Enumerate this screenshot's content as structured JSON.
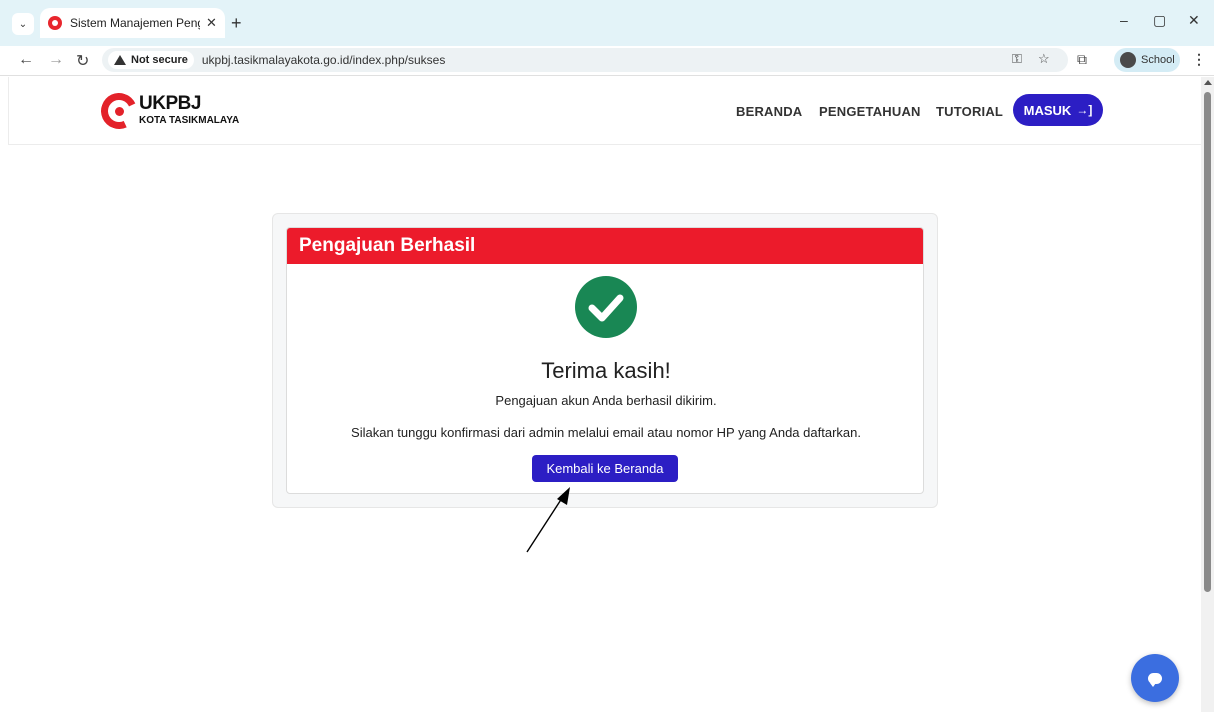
{
  "browser": {
    "tab_title": "Sistem Manajemen Pengetahuan",
    "tab_close": "✕",
    "new_tab": "+",
    "security_label": "Not secure",
    "url": "ukpbj.tasikmalayakota.go.id/index.php/sukses",
    "profile_name": "School",
    "window_controls": [
      "–",
      "▢",
      "✕"
    ]
  },
  "header": {
    "logo_title": "UKPBJ",
    "logo_subtitle": "KOTA TASIKMALAYA",
    "nav": [
      "BERANDA",
      "PENGETAHUAN",
      "TUTORIAL"
    ],
    "login_label": "MASUK",
    "login_icon": "→]"
  },
  "card": {
    "heading": "Pengajuan Berhasil",
    "thanks": "Terima kasih!",
    "message1": "Pengajuan akun Anda berhasil dikirim.",
    "message2": "Silakan tunggu konfirmasi dari admin melalui email atau nomor HP yang Anda daftarkan.",
    "back_button": "Kembali ke Beranda"
  },
  "colors": {
    "brand_red": "#ec1b2b",
    "primary_blue": "#2c1ec4",
    "success_green": "#198754",
    "chat_blue": "#3b6ee0"
  },
  "icons": {
    "tab_menu": "chevron-down-icon",
    "back": "arrow-left-icon",
    "forward": "arrow-right-icon",
    "reload": "reload-icon",
    "password": "key-icon",
    "bookmark": "star-icon",
    "extensions": "puzzle-icon",
    "success": "check-circle-icon",
    "chat": "chat-icon"
  }
}
